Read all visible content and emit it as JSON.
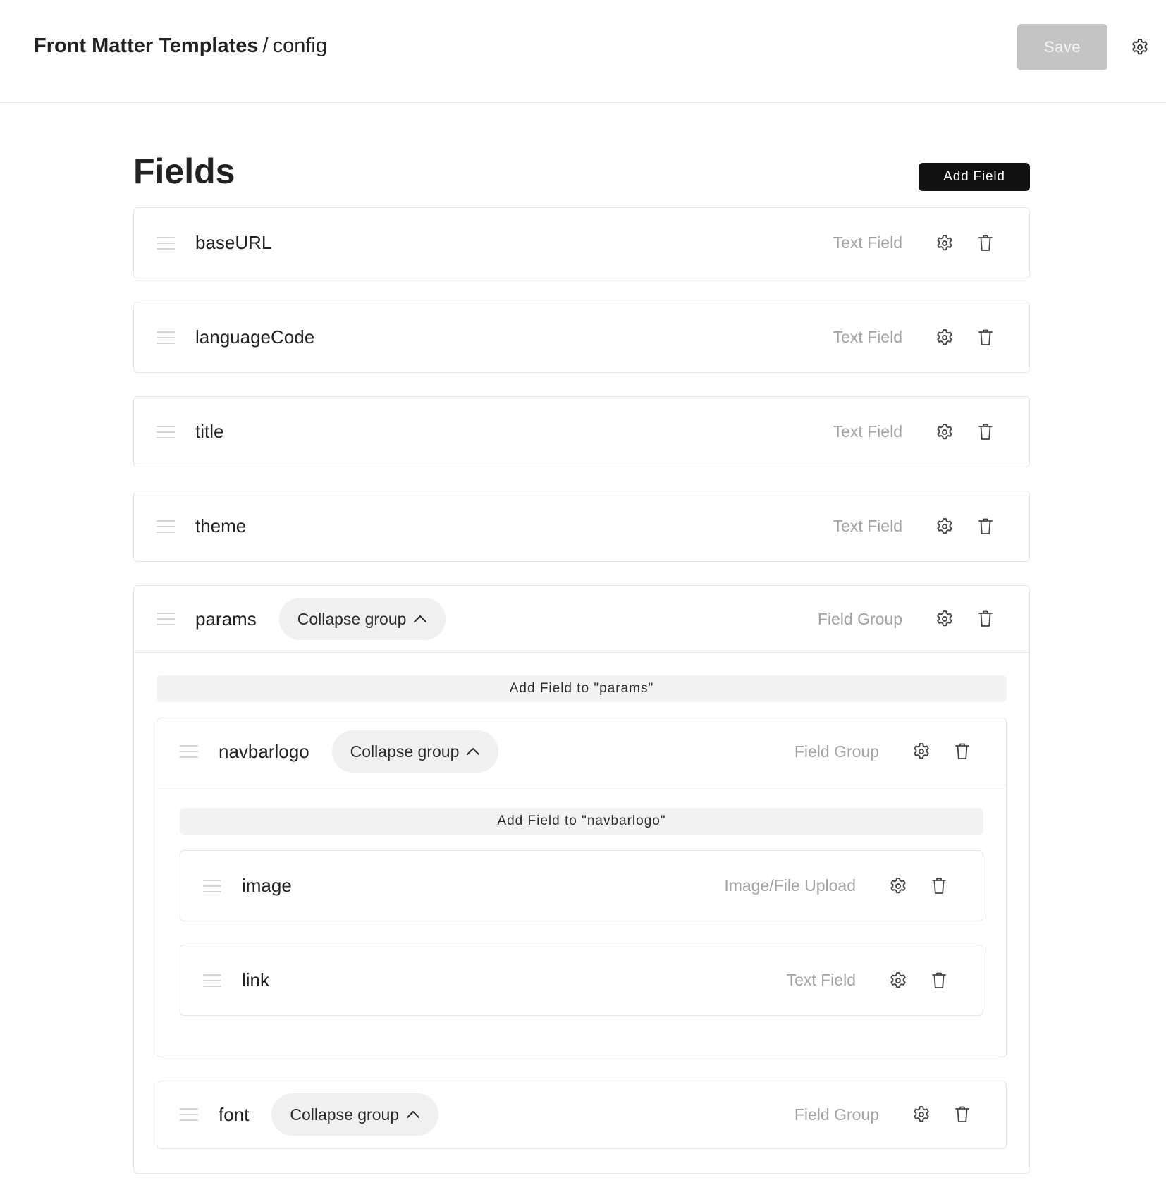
{
  "header": {
    "breadcrumb_root": "Front Matter Templates",
    "breadcrumb_sep": "/",
    "breadcrumb_current": "config",
    "save_label": "Save",
    "settings_icon": "gear-icon"
  },
  "fields_section": {
    "title": "Fields",
    "add_field_label": "Add Field"
  },
  "fields": [
    {
      "name": "baseURL",
      "type": "Text Field"
    },
    {
      "name": "languageCode",
      "type": "Text Field"
    },
    {
      "name": "title",
      "type": "Text Field"
    },
    {
      "name": "theme",
      "type": "Text Field"
    }
  ],
  "params_group": {
    "name": "params",
    "collapse_label": "Collapse group",
    "type": "Field Group",
    "add_to_label": "Add Field to \"params\"",
    "navbarlogo": {
      "name": "navbarlogo",
      "collapse_label": "Collapse group",
      "type": "Field Group",
      "add_to_label": "Add Field to \"navbarlogo\"",
      "children": [
        {
          "name": "image",
          "type": "Image/File Upload"
        },
        {
          "name": "link",
          "type": "Text Field"
        }
      ]
    },
    "font": {
      "name": "font",
      "collapse_label": "Collapse group",
      "type": "Field Group"
    }
  },
  "colors": {
    "save_disabled_bg": "#c4c4c4",
    "primary_button_bg": "#111111",
    "type_label": "#a3a3a3",
    "pill_bg": "#f0f0f0"
  }
}
